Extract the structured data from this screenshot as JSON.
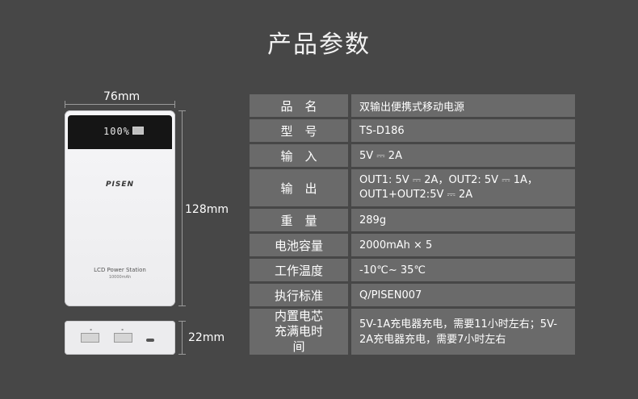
{
  "title": "产品参数",
  "dimensions": {
    "width": "76mm",
    "height": "128mm",
    "thickness": "22mm"
  },
  "device": {
    "lcd_display": "100%",
    "brand": "PISEN",
    "label": "LCD Power Station",
    "capacity_label": "10000mAh"
  },
  "specs": [
    {
      "name": "品　名",
      "value": "双输出便携式移动电源"
    },
    {
      "name": "型　号",
      "value": "TS-D186"
    },
    {
      "name": "输　入",
      "value": "5V ⎓ 2A"
    },
    {
      "name": "输　出",
      "value": "OUT1: 5V ⎓ 2A，OUT2: 5V ⎓ 1A，OUT1+OUT2:5V ⎓ 2A"
    },
    {
      "name": "重　量",
      "value": "289g"
    },
    {
      "name": "电池容量",
      "value": "2000mAh × 5"
    },
    {
      "name": "工作温度",
      "value": "-10℃~ 35℃"
    },
    {
      "name": "执行标准",
      "value": "Q/PISEN007"
    },
    {
      "name": "内置电芯充满电时间",
      "value": "5V-1A充电器充电，需要11小时左右；5V-2A充电器充电，需要7小时左右"
    }
  ]
}
